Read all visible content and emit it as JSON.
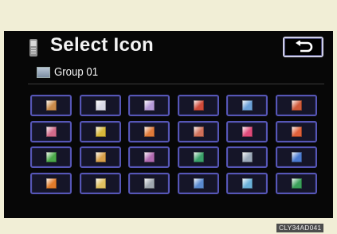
{
  "header": {
    "title": "Select Icon",
    "phone_icon": "mobile-phone-icon",
    "back_icon": "return-arrow-icon"
  },
  "group": {
    "label": "Group 01",
    "icon": "folder-icon"
  },
  "icon_grid": {
    "rows": 4,
    "columns": 6,
    "icons": [
      {
        "name": "building-icon",
        "color": "#c98a4a"
      },
      {
        "name": "document-icon",
        "color": "#d9d9e6"
      },
      {
        "name": "pencil-icon",
        "color": "#b59ad8"
      },
      {
        "name": "car-icon",
        "color": "#d04a3a"
      },
      {
        "name": "road-icon",
        "color": "#6aa0d8"
      },
      {
        "name": "door-icon",
        "color": "#d05a3a"
      },
      {
        "name": "bat-icon",
        "color": "#d26a8a"
      },
      {
        "name": "gift-icon",
        "color": "#d8b83a"
      },
      {
        "name": "cup-icon",
        "color": "#e07a3a"
      },
      {
        "name": "ticket-icon",
        "color": "#d0705a"
      },
      {
        "name": "heart-icon",
        "color": "#e04a7a"
      },
      {
        "name": "ring-icon",
        "color": "#e0603a"
      },
      {
        "name": "restaurant-icon",
        "color": "#4aa84a"
      },
      {
        "name": "coffee-icon",
        "color": "#d8a04a"
      },
      {
        "name": "book-icon",
        "color": "#b06ab0"
      },
      {
        "name": "money-icon",
        "color": "#3aa06a"
      },
      {
        "name": "monitor-icon",
        "color": "#9aa8b8"
      },
      {
        "name": "people-icon",
        "color": "#4a7ad0"
      },
      {
        "name": "pumpkin-icon",
        "color": "#e07a2a"
      },
      {
        "name": "brush-icon",
        "color": "#e0c060"
      },
      {
        "name": "tools-icon",
        "color": "#a0a8b0"
      },
      {
        "name": "boat-icon",
        "color": "#5a8ad0"
      },
      {
        "name": "landscape-icon",
        "color": "#6ab0d8"
      },
      {
        "name": "card-icon",
        "color": "#3aa05a"
      }
    ]
  },
  "footer": {
    "code": "CLY34AD041"
  },
  "colors": {
    "screen_bg": "#070707",
    "page_bg": "#f1eed6",
    "button_border": "#5656b6",
    "text": "#f3f3f3"
  }
}
